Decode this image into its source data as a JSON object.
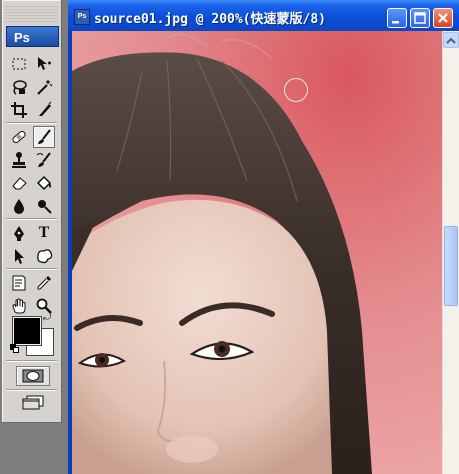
{
  "app": {
    "logo_text": "Ps"
  },
  "document": {
    "title": "source01.jpg @ 200%(快速蒙版/8)",
    "icon_text": "Ps",
    "mode": "Quick Mask",
    "zoom": "200%"
  },
  "toolbox": {
    "tools": [
      {
        "name": "marquee-tool",
        "icon": "dashed-rectangle"
      },
      {
        "name": "move-tool",
        "icon": "move-arrow"
      },
      {
        "name": "lasso-tool",
        "icon": "lasso"
      },
      {
        "name": "magic-wand-tool",
        "icon": "magic-wand"
      },
      {
        "name": "crop-tool",
        "icon": "crop"
      },
      {
        "name": "slice-tool",
        "icon": "slice-knife"
      },
      {
        "name": "healing-brush-tool",
        "icon": "bandage"
      },
      {
        "name": "brush-tool",
        "icon": "brush",
        "active": true
      },
      {
        "name": "clone-stamp-tool",
        "icon": "stamp"
      },
      {
        "name": "history-brush-tool",
        "icon": "history-brush"
      },
      {
        "name": "eraser-tool",
        "icon": "eraser"
      },
      {
        "name": "paint-bucket-tool",
        "icon": "bucket"
      },
      {
        "name": "blur-tool",
        "icon": "drop"
      },
      {
        "name": "dodge-tool",
        "icon": "dodge"
      },
      {
        "name": "pen-tool",
        "icon": "pen"
      },
      {
        "name": "type-tool",
        "icon": "type-T"
      },
      {
        "name": "path-selection-tool",
        "icon": "arrow"
      },
      {
        "name": "custom-shape-tool",
        "icon": "blob"
      },
      {
        "name": "notes-tool",
        "icon": "note"
      },
      {
        "name": "eyedropper-tool",
        "icon": "eyedropper"
      },
      {
        "name": "hand-tool",
        "icon": "hand"
      },
      {
        "name": "zoom-tool",
        "icon": "magnifier"
      }
    ],
    "foreground_color": "#000000",
    "background_color": "#ffffff"
  },
  "colors": {
    "title_bar": "#0b4fd8",
    "quick_mask_overlay": "#e08c90",
    "toolbox_bg": "#d6d3ce"
  }
}
